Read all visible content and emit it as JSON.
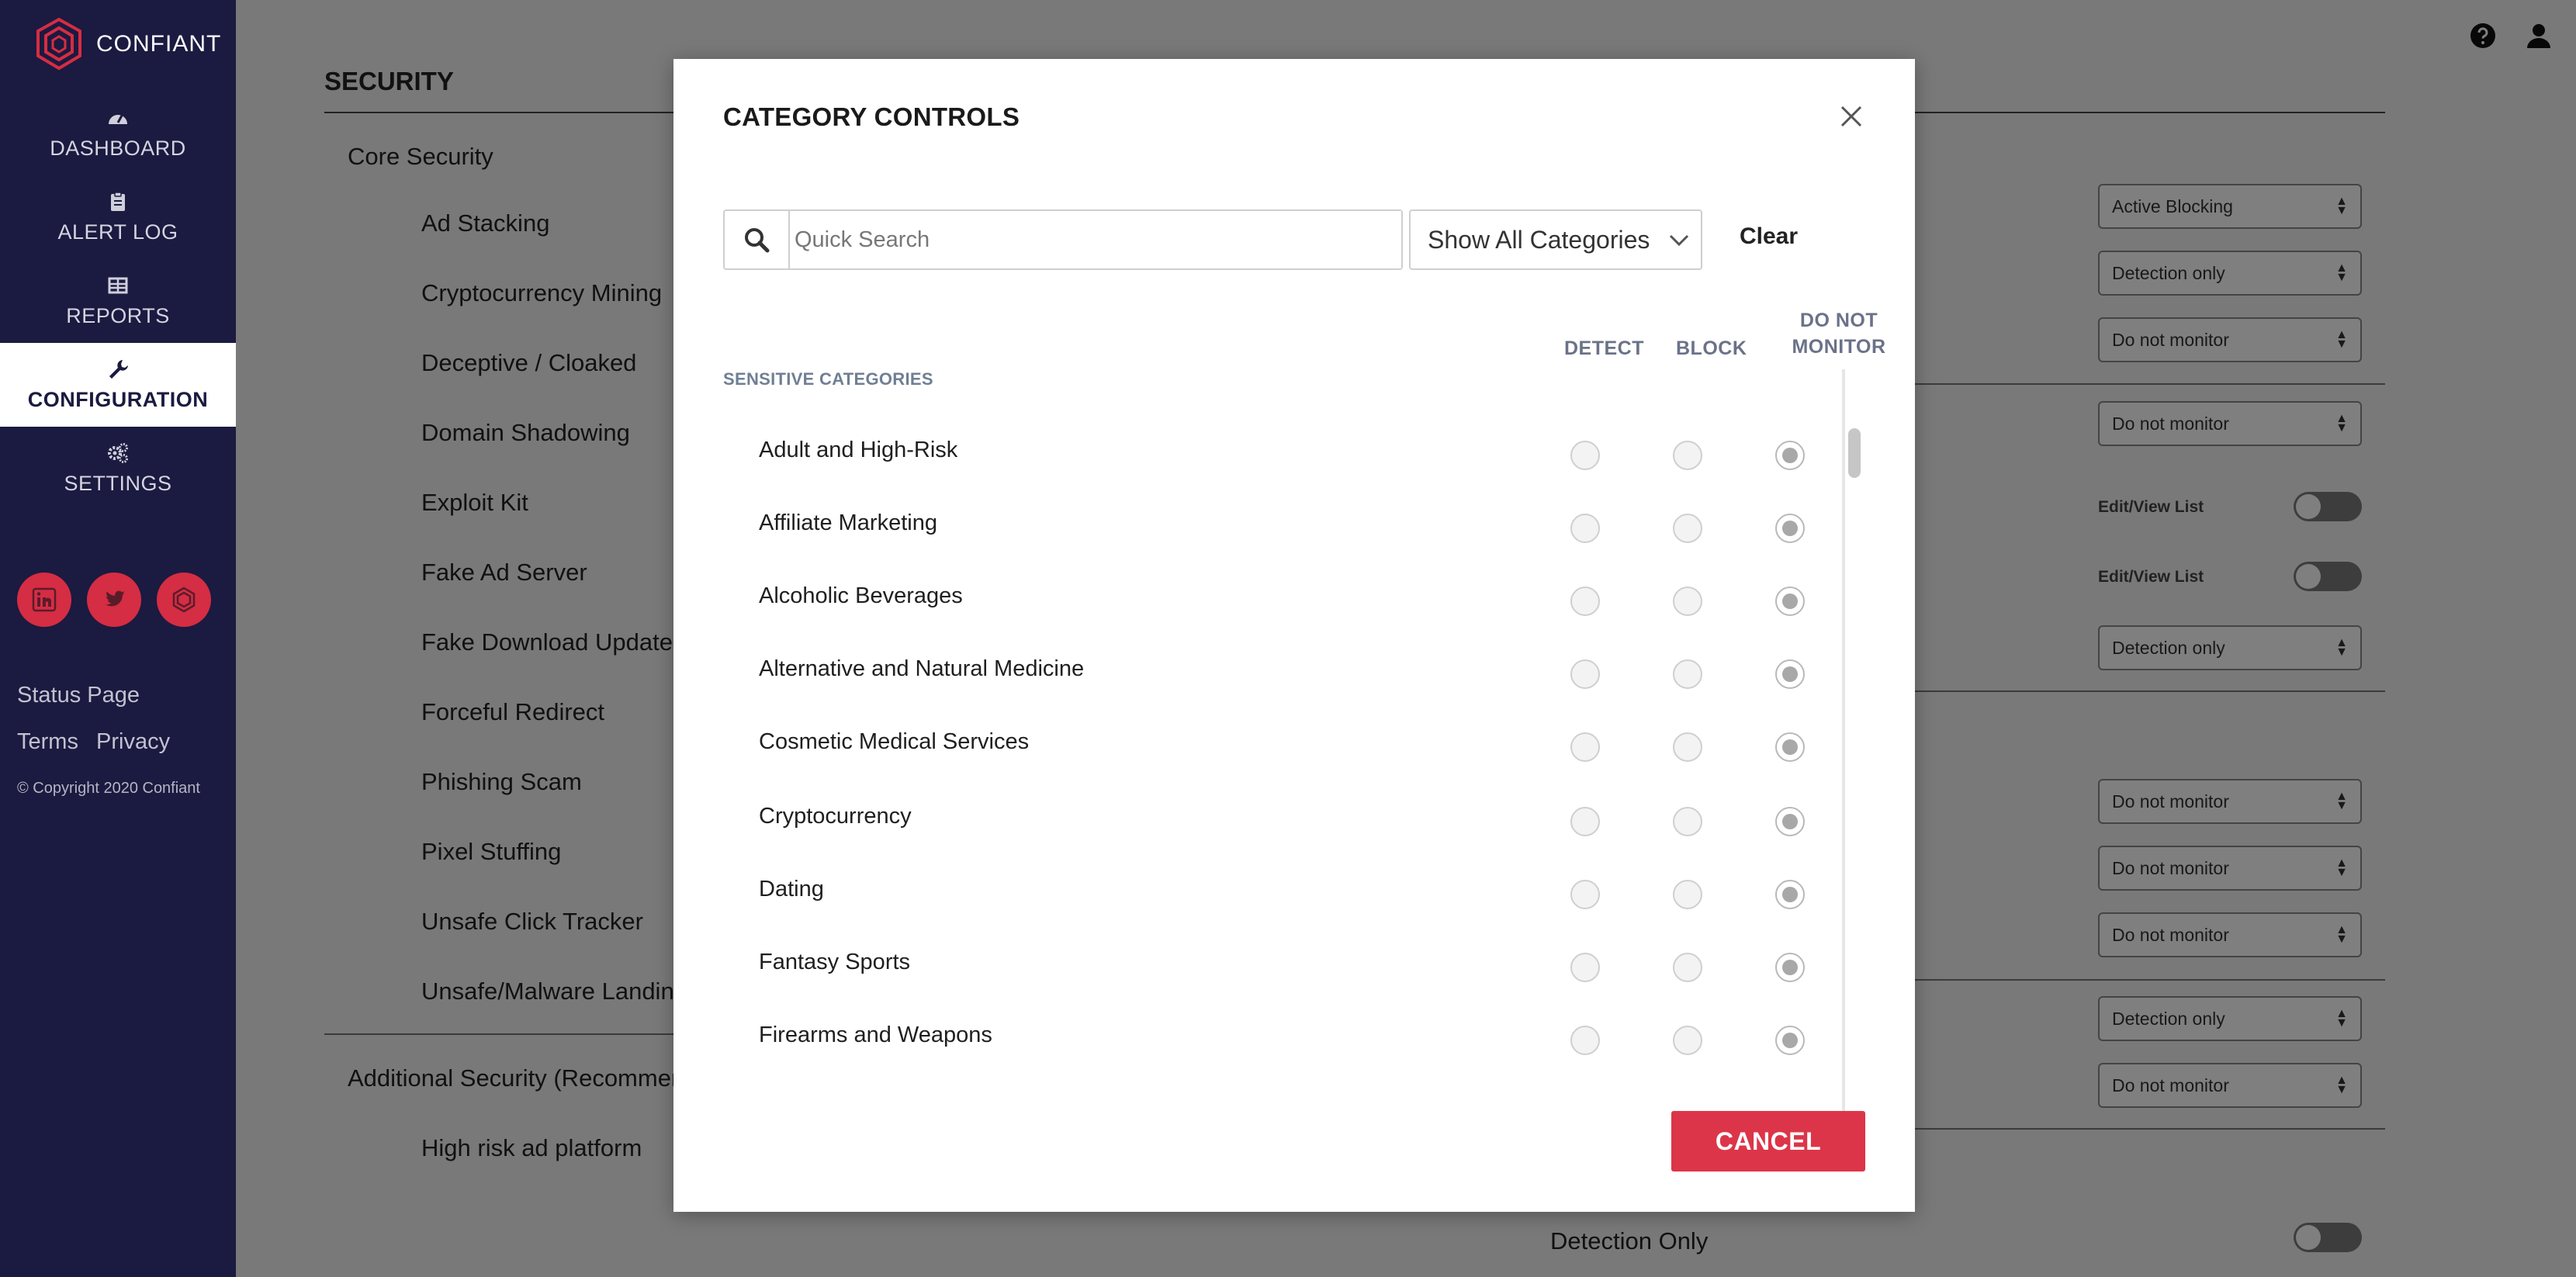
{
  "app": {
    "brand": "CONFIANT"
  },
  "sidebar": {
    "nav": [
      {
        "label": "DASHBOARD",
        "icon": "gauge-icon"
      },
      {
        "label": "ALERT LOG",
        "icon": "clipboard-icon"
      },
      {
        "label": "REPORTS",
        "icon": "table-icon"
      },
      {
        "label": "CONFIGURATION",
        "icon": "wrench-icon",
        "active": true
      },
      {
        "label": "SETTINGS",
        "icon": "gears-icon"
      }
    ],
    "socials": [
      "linkedin-icon",
      "twitter-icon",
      "confiant-icon"
    ],
    "status_page": "Status Page",
    "terms": "Terms",
    "privacy": "Privacy",
    "copyright": "© Copyright 2020 Confiant"
  },
  "topbar": {
    "icons": [
      "help-icon",
      "user-icon"
    ]
  },
  "background": {
    "section_title": "SECURITY",
    "core_security": "Core Security",
    "items": [
      "Ad Stacking",
      "Cryptocurrency Mining",
      "Deceptive / Cloaked",
      "Domain Shadowing",
      "Exploit Kit",
      "Fake Ad Server",
      "Fake Download Update",
      "Forceful Redirect",
      "Phishing Scam",
      "Pixel Stuffing",
      "Unsafe Click Tracker",
      "Unsafe/Malware Landing"
    ],
    "additional_security": "Additional Security (Recommen",
    "high_risk": "High risk ad platform",
    "detection_only_label": "Detection Only",
    "selects": [
      "Active Blocking",
      "Detection only",
      "Do not monitor",
      "Do not monitor",
      "Detection only",
      "Do not monitor",
      "Do not monitor",
      "Do not monitor",
      "Detection only",
      "Do not monitor"
    ],
    "edit_view_list": "Edit/View List"
  },
  "modal": {
    "title": "CATEGORY CONTROLS",
    "search_placeholder": "Quick Search",
    "filter_value": "Show All Categories",
    "clear_label": "Clear",
    "columns": {
      "detect": "DETECT",
      "block": "BLOCK",
      "do_not": "DO NOT",
      "monitor": "MONITOR"
    },
    "group_label": "SENSITIVE CATEGORIES",
    "categories": [
      {
        "name": "Adult and High-Risk",
        "selected": "do_not_monitor"
      },
      {
        "name": "Affiliate Marketing",
        "selected": "do_not_monitor"
      },
      {
        "name": "Alcoholic Beverages",
        "selected": "do_not_monitor"
      },
      {
        "name": "Alternative and Natural Medicine",
        "selected": "do_not_monitor"
      },
      {
        "name": "Cosmetic Medical Services",
        "selected": "do_not_monitor"
      },
      {
        "name": "Cryptocurrency",
        "selected": "do_not_monitor"
      },
      {
        "name": "Dating",
        "selected": "do_not_monitor"
      },
      {
        "name": "Fantasy Sports",
        "selected": "do_not_monitor"
      },
      {
        "name": "Firearms and Weapons",
        "selected": "do_not_monitor"
      }
    ],
    "cancel_label": "CANCEL"
  },
  "colors": {
    "sidebar_bg": "#1b1a40",
    "accent_red": "#dc3549",
    "overlay": "rgba(0,0,0,0.5)"
  }
}
